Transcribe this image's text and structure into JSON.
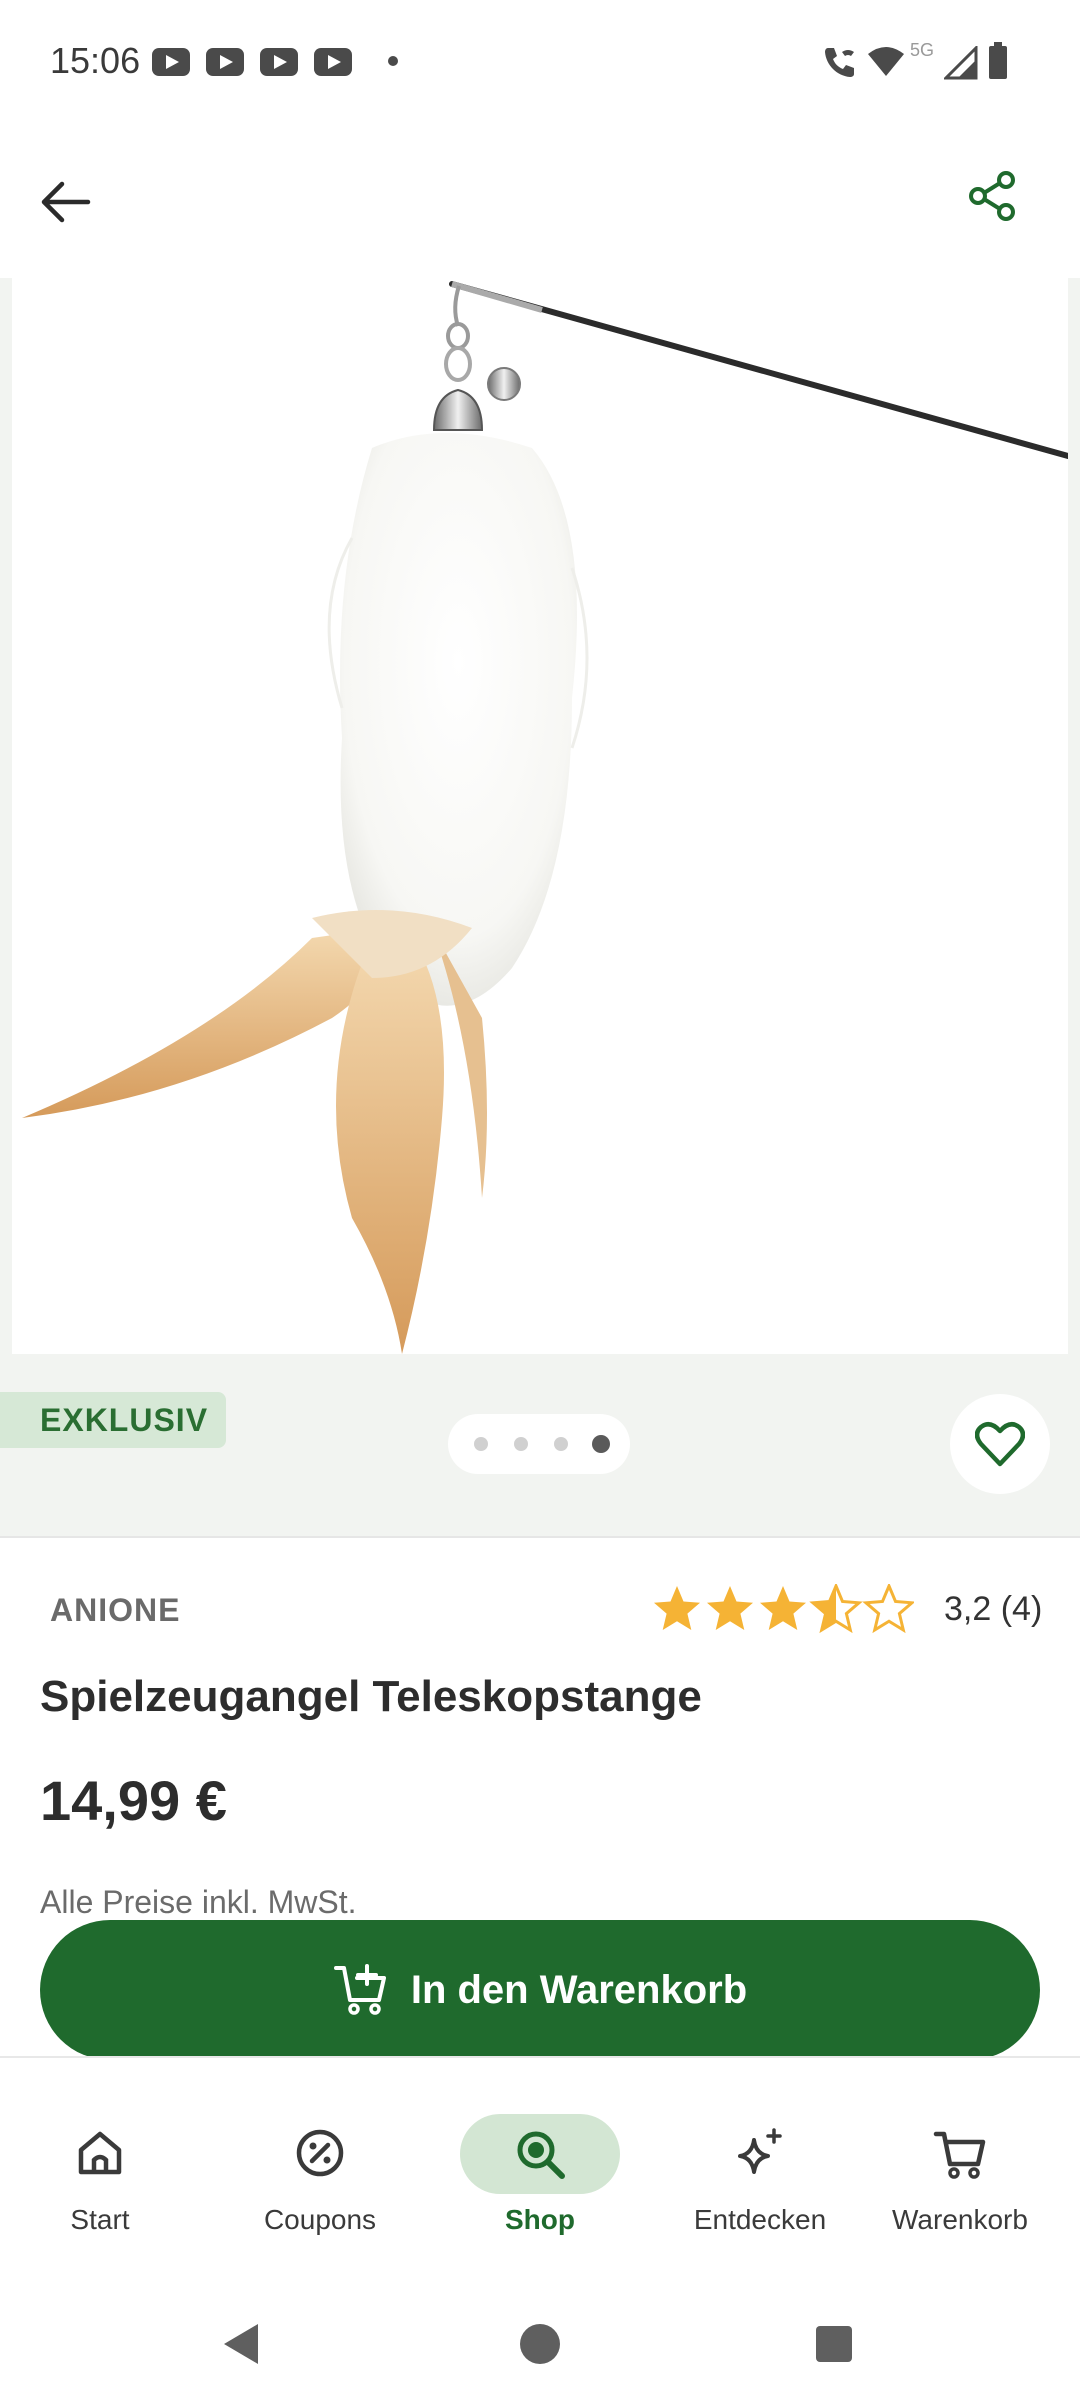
{
  "status_bar": {
    "time": "15:06",
    "notification_icons": [
      "youtube-icon",
      "youtube-icon",
      "youtube-icon",
      "youtube-icon"
    ],
    "network_label": "5G",
    "system_icons": [
      "wifi-calling-icon",
      "wifi-icon",
      "cell-signal-icon",
      "battery-icon"
    ]
  },
  "app_bar": {
    "back_icon": "arrow-left-icon",
    "share_icon": "share-icon"
  },
  "product": {
    "badge": "EXKLUSIV",
    "pager": {
      "count": 4,
      "active_index": 3
    },
    "brand": "ANIONE",
    "rating_value": 3.2,
    "rating_text": "3,2 (4)",
    "stars_max": 5,
    "title": "Spielzeugangel Teleskopstange",
    "price": "14,99 €",
    "vat_note": "Alle Preise inkl. MwSt.",
    "add_to_cart_label": "In den Warenkorb"
  },
  "bottom_nav": {
    "items": [
      {
        "label": "Start",
        "icon": "home-icon"
      },
      {
        "label": "Coupons",
        "icon": "coupon-icon"
      },
      {
        "label": "Shop",
        "icon": "search-icon",
        "active": true
      },
      {
        "label": "Entdecken",
        "icon": "sparkle-icon"
      },
      {
        "label": "Warenkorb",
        "icon": "cart-icon"
      }
    ]
  },
  "colors": {
    "brand_green": "#1f6a2d",
    "badge_bg": "#d6e8d6",
    "star": "#f5b335",
    "gallery_bg": "#f2f4f1"
  }
}
